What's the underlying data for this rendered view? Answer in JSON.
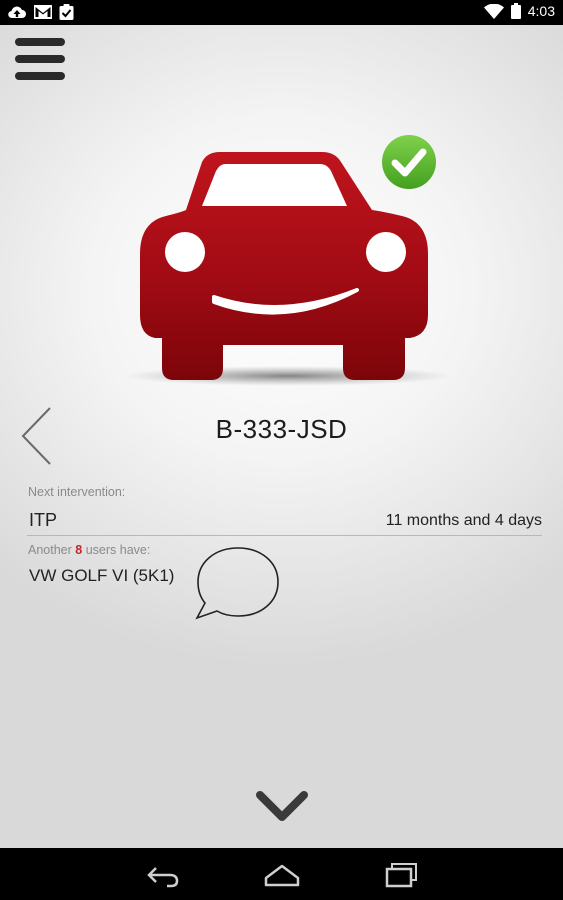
{
  "status_bar": {
    "time": "4:03",
    "icons": [
      "cloud-upload-icon",
      "gmail-icon",
      "clipboard-check-icon",
      "wifi-icon",
      "battery-icon"
    ]
  },
  "toolbar": {
    "menu_icon": "hamburger-menu-icon"
  },
  "vehicle": {
    "plate": "B-333-JSD",
    "status_icon": "check-circle-icon",
    "colors": {
      "car": "#a10b14",
      "check": "#58b82e"
    }
  },
  "intervention": {
    "label": "Next intervention:",
    "type": "ITP",
    "time_left": "11 months and 4 days"
  },
  "community": {
    "label_prefix": "Another",
    "count": "8",
    "label_suffix": "users have:",
    "model": "VW GOLF VI (5K1)",
    "bubble_icon": "speech-bubble-icon"
  },
  "nav": {
    "prev_icon": "chevron-left-icon",
    "more_icon": "chevron-down-icon"
  },
  "system_nav": {
    "icons": [
      "back-icon",
      "home-icon",
      "recent-apps-icon"
    ]
  }
}
